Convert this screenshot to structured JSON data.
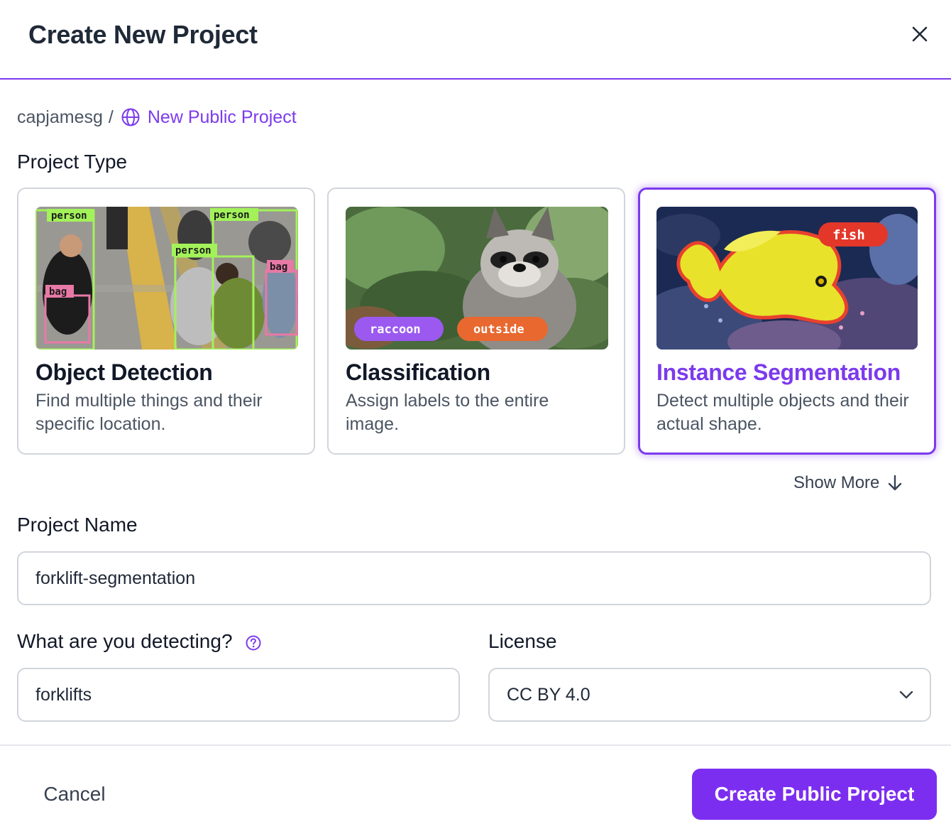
{
  "dialog": {
    "title": "Create New Project",
    "close_icon": "close-icon"
  },
  "breadcrumb": {
    "user": "capjamesg",
    "separator": "/",
    "project": "New Public Project",
    "icon": "globe-icon"
  },
  "project_type": {
    "label": "Project Type",
    "cards": [
      {
        "title": "Object Detection",
        "description": "Find multiple things and their specific location.",
        "selected": false,
        "image_tags": [
          "person",
          "person",
          "person",
          "bag",
          "bag"
        ]
      },
      {
        "title": "Classification",
        "description": "Assign labels to the entire image.",
        "selected": false,
        "image_tags": [
          "raccoon",
          "outside"
        ]
      },
      {
        "title": "Instance Segmentation",
        "description": "Detect multiple objects and their actual shape.",
        "selected": true,
        "image_tags": [
          "fish"
        ]
      }
    ],
    "show_more": "Show More"
  },
  "project_name": {
    "label": "Project Name",
    "value": "forklift-segmentation"
  },
  "detecting": {
    "label": "What are you detecting?",
    "value": "forklifts",
    "help_icon": "help-circle-icon"
  },
  "license": {
    "label": "License",
    "value": "CC BY 4.0"
  },
  "footer": {
    "cancel": "Cancel",
    "create": "Create Public Project"
  },
  "colors": {
    "accent": "#7c3aed",
    "button": "#7c2ef0",
    "border": "#d1d5db"
  }
}
